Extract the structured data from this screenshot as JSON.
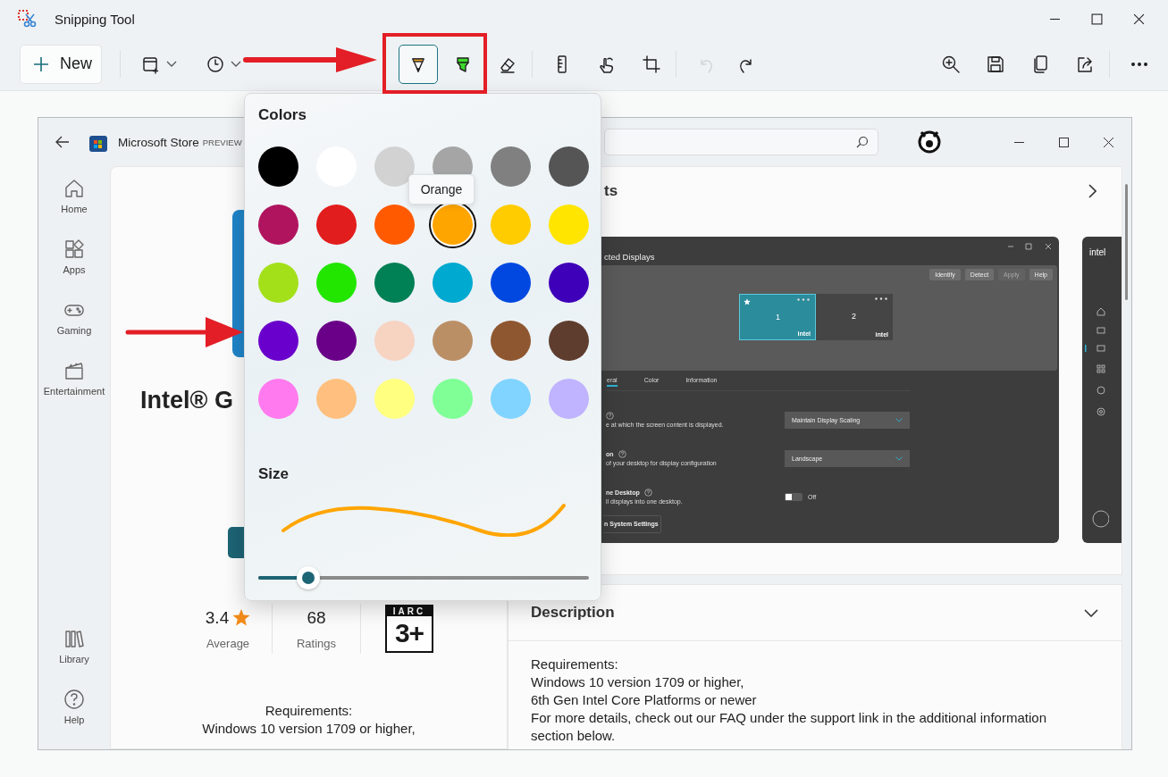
{
  "window": {
    "title": "Snipping Tool"
  },
  "toolbar": {
    "new_label": "New",
    "tools": [
      {
        "kind": "snip-mode",
        "selected": false,
        "disabled": false
      },
      {
        "kind": "timer",
        "selected": false,
        "disabled": false
      },
      {
        "kind": "pen",
        "selected": true,
        "disabled": false
      },
      {
        "kind": "highlighter",
        "selected": false,
        "disabled": false
      },
      {
        "kind": "eraser",
        "selected": false,
        "disabled": false
      },
      {
        "kind": "ruler",
        "selected": false,
        "disabled": false
      },
      {
        "kind": "touch",
        "selected": false,
        "disabled": false
      },
      {
        "kind": "crop",
        "selected": false,
        "disabled": false
      },
      {
        "kind": "undo",
        "selected": false,
        "disabled": true
      },
      {
        "kind": "redo",
        "selected": false,
        "disabled": false
      },
      {
        "kind": "zoom",
        "selected": false,
        "disabled": false
      },
      {
        "kind": "save",
        "selected": false,
        "disabled": false
      },
      {
        "kind": "copy",
        "selected": false,
        "disabled": false
      },
      {
        "kind": "share",
        "selected": false,
        "disabled": false
      },
      {
        "kind": "more",
        "selected": false,
        "disabled": false
      }
    ]
  },
  "capture": {
    "app_title": "Microsoft Store",
    "app_badge": "PREVIEW",
    "nav": [
      {
        "kind": "home",
        "label": "Home"
      },
      {
        "kind": "apps",
        "label": "Apps"
      },
      {
        "kind": "gaming",
        "label": "Gaming"
      },
      {
        "kind": "entertainment",
        "label": "Entertainment"
      },
      {
        "kind": "library",
        "label": "Library"
      },
      {
        "kind": "help",
        "label": "Help"
      }
    ],
    "product": {
      "title": "Intel® G",
      "rating": "3.4",
      "rating_label": "Average",
      "ratings_count": "68",
      "ratings_label": "Ratings",
      "age_org": "IARC",
      "age": "3+",
      "requirements": [
        "Requirements:",
        "Windows 10 version 1709 or higher,"
      ]
    },
    "screenshots": {
      "title": "ts",
      "shot": {
        "title": "cted Displays",
        "buttons": [
          {
            "label": "Identify",
            "disabled": false
          },
          {
            "label": "Detect",
            "disabled": false
          },
          {
            "label": "Apply",
            "disabled": true
          },
          {
            "label": "Help",
            "disabled": false
          }
        ],
        "displays": [
          {
            "number": "1",
            "brand": "intel",
            "selected": true
          },
          {
            "number": "2",
            "brand": "intel",
            "selected": false
          }
        ],
        "tabs": [
          {
            "label": "eral",
            "selected": true
          },
          {
            "label": "Color",
            "selected": false
          },
          {
            "label": "Information",
            "selected": false
          }
        ],
        "settings": [
          {
            "kind": "dropdown",
            "desc": "e at which the screen content is displayed.",
            "value": "Maintain Display Scaling"
          },
          {
            "kind": "dropdown",
            "name": "on",
            "desc": "of your desktop for display configuration",
            "value": "Landscape"
          },
          {
            "kind": "toggle",
            "name": "ne Desktop",
            "desc": "ll displays into one desktop.",
            "on": false,
            "value": "Off"
          }
        ],
        "footer_button": "n System Settings"
      },
      "side_logo": "intel"
    },
    "description": {
      "title": "Description",
      "lines": [
        "Requirements:",
        "Windows 10 version 1709 or higher,",
        "6th Gen Intel Core Platforms or newer",
        "For more details, check out our FAQ under the support link in the additional information",
        "section below."
      ]
    }
  },
  "colors_panel": {
    "title": "Colors",
    "tooltip": "Orange",
    "size_label": "Size",
    "size": {
      "level": 0.15
    },
    "swatches": [
      {
        "color": "#000000",
        "selected": false
      },
      {
        "color": "#ffffff",
        "selected": false
      },
      {
        "color": "#d2d2d2",
        "selected": false
      },
      {
        "color": "#a5a5a5",
        "selected": false
      },
      {
        "color": "#808080",
        "selected": false
      },
      {
        "color": "#555555",
        "selected": false
      },
      {
        "color": "#b0145f",
        "selected": false
      },
      {
        "color": "#e21d1d",
        "selected": false
      },
      {
        "color": "#ff5a00",
        "selected": false
      },
      {
        "color": "#ffa500",
        "selected": true
      },
      {
        "color": "#ffcc00",
        "selected": false
      },
      {
        "color": "#ffe500",
        "selected": false
      },
      {
        "color": "#a3e01a",
        "selected": false
      },
      {
        "color": "#22e600",
        "selected": false
      },
      {
        "color": "#008055",
        "selected": false
      },
      {
        "color": "#00a9cf",
        "selected": false
      },
      {
        "color": "#0048e0",
        "selected": false
      },
      {
        "color": "#3e00b8",
        "selected": false
      },
      {
        "color": "#6a00cc",
        "selected": false
      },
      {
        "color": "#6a0088",
        "selected": false
      },
      {
        "color": "#f7d3c1",
        "selected": false
      },
      {
        "color": "#bb8f66",
        "selected": false
      },
      {
        "color": "#8f5730",
        "selected": false
      },
      {
        "color": "#5e3d2e",
        "selected": false
      },
      {
        "color": "#ff7aef",
        "selected": false
      },
      {
        "color": "#ffc07f",
        "selected": false
      },
      {
        "color": "#ffff80",
        "selected": false
      },
      {
        "color": "#7fff95",
        "selected": false
      },
      {
        "color": "#80d4ff",
        "selected": false
      },
      {
        "color": "#c0b3ff",
        "selected": false
      }
    ]
  }
}
